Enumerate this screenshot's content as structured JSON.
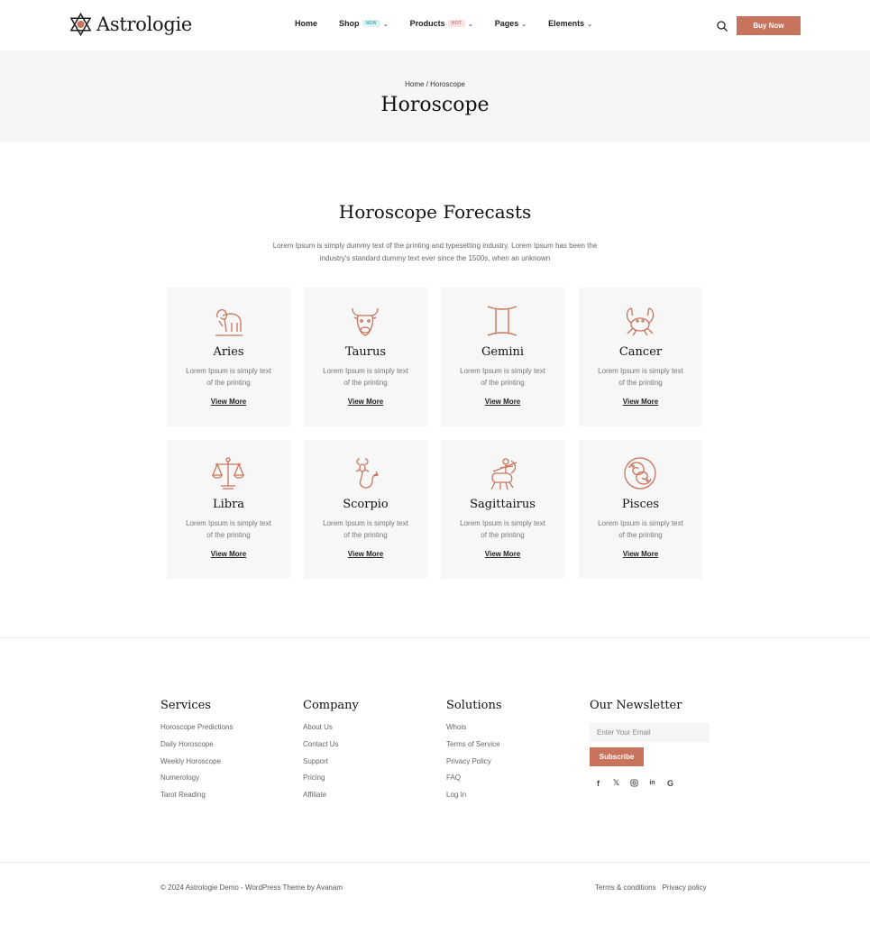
{
  "brand": {
    "name": "Astrologie",
    "accent": "#c8735b"
  },
  "nav": {
    "items": [
      {
        "label": "Home",
        "badge": "",
        "chevron": false
      },
      {
        "label": "Shop",
        "badge": "NEW",
        "chevron": true
      },
      {
        "label": "Products",
        "badge": "HOT",
        "chevron": true
      },
      {
        "label": "Pages",
        "badge": "",
        "chevron": true
      },
      {
        "label": "Elements",
        "badge": "",
        "chevron": true
      }
    ],
    "buy_label": "Buy Now"
  },
  "title_band": {
    "breadcrumb": "Home / Horoscope",
    "title": "Horoscope"
  },
  "section": {
    "title": "Horoscope Forecasts",
    "description": "Lorem Ipsum is simply dummy text of the printing and typesetting industry. Lorem Ipsum has been the industry's standard dummy text ever since the 1500s, when an unknown"
  },
  "signs": [
    {
      "name": "Aries",
      "icon": "aries-icon",
      "desc": "Lorem Ipsum is simply text of the printing",
      "link": "View More"
    },
    {
      "name": "Taurus",
      "icon": "taurus-icon",
      "desc": "Lorem Ipsum is simply text of the printing",
      "link": "View More"
    },
    {
      "name": "Gemini",
      "icon": "gemini-icon",
      "desc": "Lorem Ipsum is simply text of the printing",
      "link": "View More"
    },
    {
      "name": "Cancer",
      "icon": "cancer-icon",
      "desc": "Lorem Ipsum is simply text of the printing",
      "link": "View More"
    },
    {
      "name": "Libra",
      "icon": "libra-icon",
      "desc": "Lorem Ipsum is simply text of the printing",
      "link": "View More"
    },
    {
      "name": "Scorpio",
      "icon": "scorpio-icon",
      "desc": "Lorem Ipsum is simply text of the printing",
      "link": "View More"
    },
    {
      "name": "Sagittairus",
      "icon": "sagittarius-icon",
      "desc": "Lorem Ipsum is simply text of the printing",
      "link": "View More"
    },
    {
      "name": "Pisces",
      "icon": "pisces-icon",
      "desc": "Lorem Ipsum is simply text of the printing",
      "link": "View More"
    }
  ],
  "footer": {
    "services": {
      "title": "Services",
      "links": [
        "Horoscope Predictions",
        "Daily Horoscope",
        "Weekly Horoscope",
        "Numerology",
        "Tarot Reading"
      ]
    },
    "company": {
      "title": "Company",
      "links": [
        "About Us",
        "Contact Us",
        "Support",
        "Pricing",
        "Affiliate"
      ]
    },
    "solutions": {
      "title": "Solutions",
      "links": [
        "Whois",
        "Terms of Service",
        "Privacy Policy",
        "FAQ",
        "Log In"
      ]
    },
    "newsletter": {
      "title": "Our Newsletter",
      "placeholder": "Enter Your Email",
      "button": "Subscribe"
    },
    "socials": [
      "facebook-icon",
      "x-icon",
      "instagram-icon",
      "linkedin-icon",
      "google-icon"
    ],
    "copyright": "© 2024 Astrologie Demo - WordPress Theme by Avanam",
    "bottom_links": [
      "Terms & conditions",
      "Privacy policy"
    ]
  }
}
